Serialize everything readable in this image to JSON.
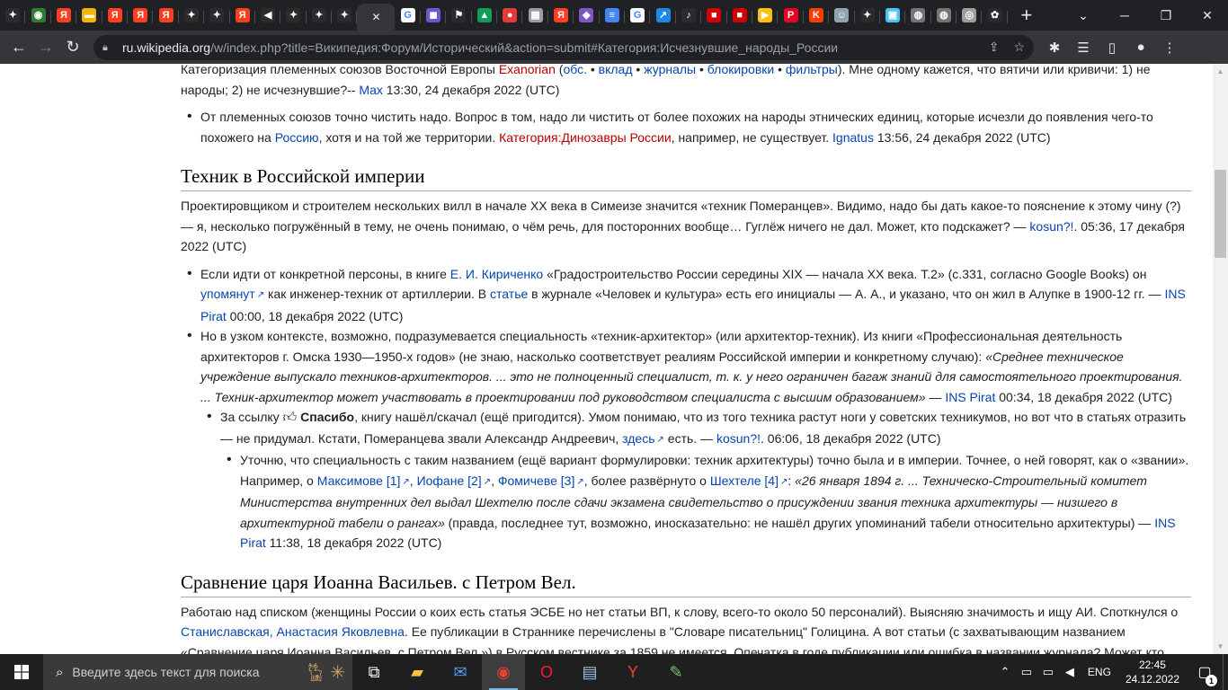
{
  "browser": {
    "tabs": [
      {
        "icon": "sparkle-icon",
        "color": "#2b2b2b",
        "glyph": "✦"
      },
      {
        "icon": "globe-icon",
        "color": "#2e7d32",
        "glyph": "◉"
      },
      {
        "icon": "yandex-icon",
        "color": "#fc3f1d",
        "glyph": "Я"
      },
      {
        "icon": "slides-icon",
        "color": "#f4b400",
        "glyph": "▬"
      },
      {
        "icon": "yandex-icon",
        "color": "#fc3f1d",
        "glyph": "Я"
      },
      {
        "icon": "yandex-icon",
        "color": "#fc3f1d",
        "glyph": "Я"
      },
      {
        "icon": "yandex-icon",
        "color": "#fc3f1d",
        "glyph": "Я"
      },
      {
        "icon": "sparkle-icon",
        "color": "#2b2b2b",
        "glyph": "✦"
      },
      {
        "icon": "sparkle-icon",
        "color": "#2b2b2b",
        "glyph": "✦"
      },
      {
        "icon": "yandex-icon",
        "color": "#fc3f1d",
        "glyph": "Я"
      },
      {
        "icon": "speaker-icon",
        "color": "#2b2b2b",
        "glyph": "◀"
      },
      {
        "icon": "sparkle-icon",
        "color": "#2b2b2b",
        "glyph": "✦"
      },
      {
        "icon": "sparkle-icon",
        "color": "#2b2b2b",
        "glyph": "✦"
      },
      {
        "icon": "sparkle-icon",
        "color": "#2b2b2b",
        "glyph": "✦"
      },
      {
        "icon": "google-icon",
        "color": "#ffffff",
        "glyph": "G"
      },
      {
        "icon": "media-icon",
        "color": "#6a5acd",
        "glyph": "◼"
      },
      {
        "icon": "flag-icon",
        "color": "#2b2b2b",
        "glyph": "⚑"
      },
      {
        "icon": "drive-icon",
        "color": "#0f9d58",
        "glyph": "▲"
      },
      {
        "icon": "pokeball-icon",
        "color": "#e53935",
        "glyph": "●"
      },
      {
        "icon": "image-icon",
        "color": "#9e9e9e",
        "glyph": "▦"
      },
      {
        "icon": "yandex-icon",
        "color": "#fc3f1d",
        "glyph": "Я"
      },
      {
        "icon": "games-icon",
        "color": "#7e57c2",
        "glyph": "◆"
      },
      {
        "icon": "docs-icon",
        "color": "#4285f4",
        "glyph": "≡"
      },
      {
        "icon": "google-icon",
        "color": "#ffffff",
        "glyph": "G"
      },
      {
        "icon": "chart-icon",
        "color": "#1e88e5",
        "glyph": "↗"
      },
      {
        "icon": "tiktok-icon",
        "color": "#2b2b2b",
        "glyph": "♪"
      },
      {
        "icon": "redflag-icon",
        "color": "#d50000",
        "glyph": "■"
      },
      {
        "icon": "redflag-icon",
        "color": "#d50000",
        "glyph": "■"
      },
      {
        "icon": "play-icon",
        "color": "#ffc107",
        "glyph": "▶"
      },
      {
        "icon": "pinterest-icon",
        "color": "#e60023",
        "glyph": "P"
      },
      {
        "icon": "kinopoisk-icon",
        "color": "#ff3d00",
        "glyph": "K"
      },
      {
        "icon": "avatar-icon",
        "color": "#90a4ae",
        "glyph": "☺"
      },
      {
        "icon": "sparkle-icon",
        "color": "#2b2b2b",
        "glyph": "✦"
      },
      {
        "icon": "photo-icon",
        "color": "#4fc3f7",
        "glyph": "▣"
      },
      {
        "icon": "globe-gray-icon",
        "color": "#757575",
        "glyph": "◍"
      },
      {
        "icon": "globe-gray-icon",
        "color": "#757575",
        "glyph": "◍"
      },
      {
        "icon": "chrome-icon",
        "color": "#9e9e9e",
        "glyph": "◎"
      },
      {
        "icon": "openai-icon",
        "color": "#2b2b2b",
        "glyph": "✿"
      }
    ],
    "active_tab_close": "✕",
    "new_tab": "+",
    "url_host": "ru.wikipedia.org",
    "url_rest": "/w/index.php?title=Википедия:Форум/Исторический&action=submit#Категория:Исчезнувшие_народы_России"
  },
  "article": {
    "top_p_parts": [
      "Категоризация племенных союзов Восточной Европы ",
      "Exanorian",
      " (",
      "обс.",
      " • ",
      "вклад",
      " • ",
      "журналы",
      " • ",
      "блокировки",
      " • ",
      "фильтры",
      "). Мне одному кажется, что вятичи или кривичи: 1) не народы; 2) не исчезнувшие?-- ",
      "Max",
      " 13:30, 24 декабря 2022 (UTC)"
    ],
    "reply1": {
      "t1": "От племенных союзов точно чистить надо. Вопрос в том, надо ли чистить от более похожих на народы этнических единиц, которые исчезли до появления чего-то похожего на ",
      "link1": "Россию",
      "t2": ", хотя и на той же территории. ",
      "link2": "Категория:Динозавры России",
      "t3": ", например, не существует. ",
      "link3": "Ignatus",
      "t4": " 13:56, 24 декабря 2022 (UTC)"
    },
    "heading1": "Техник в Российской империи",
    "p2": {
      "t1": "Проектировщиком и строителем нескольких вилл в начале XX века в Симеизе значится «техник Померанцев». Видимо, надо бы дать какое-то пояснение к этому чину (?) — я, несколько погружённый в тему, не очень понимаю, о чём речь, для посторонних вообще… Гуглёж ничего не дал. Может, кто подскажет? — ",
      "link1": "kosun?!",
      "t2": ". 05:36, 17 декабря 2022 (UTC)"
    },
    "reply2": {
      "t1": "Если идти от конкретной персоны, в книге ",
      "link1": "Е. И. Кириченко",
      "t2": " «Градостроительство России середины XIX — начала XX века. Т.2» (с.331, согласно Google Books) он ",
      "link2": "упомянут",
      "t3": " как инженер-техник от артиллерии. В ",
      "link3": "статье",
      "t4": " в журнале «Человек и культура» есть его инициалы — А. А., и указано, что он жил в Алупке в 1900-12 гг. — ",
      "link4": "INS Pirat",
      "t5": " 00:00, 18 декабря 2022 (UTC)"
    },
    "reply3": {
      "t1": "Но в узком контексте, возможно, подразумевается специальность «техник-архитектор» (или архитектор-техник). Из книги «Профессиональная деятельность архитекторов г. Омска 1930—1950-х годов» (не знаю, насколько соответствует реалиям Российской империи и конкретному случаю): ",
      "quote": "«Среднее техническое учреждение выпускало техников-архитекторов. ... это не полноценный специалист, т. к. у него ограничен багаж знаний для самостоятельного проектирования. ... Техник-архитектор может участвовать в проектировании под руководством специалиста с высшим образованием»",
      "t2": " — ",
      "link1": "INS Pirat",
      "t3": " 00:34, 18 декабря 2022 (UTC)"
    },
    "reply4": {
      "t1": "За ссылку ",
      "thanks": "Спасибо",
      "t2": ", книгу нашёл/скачал (ещё пригодится). Умом понимаю, что из того техника растут ноги у советских техникумов, но вот что в статьях отразить — не придумал. Кстати, Померанцева звали Александр Андреевич, ",
      "link1": "здесь",
      "t3": " есть. — ",
      "link2": "kosun?!",
      "t4": ". 06:06, 18 декабря 2022 (UTC)"
    },
    "reply5": {
      "t1": "Уточню, что специальность с таким названием (ещё вариант формулировки: техник архитектуры) точно была и в империи. Точнее, о ней говорят, как о «звании». Например, о ",
      "link1": "Максимове [1]",
      "t2": ", ",
      "link2": "Иофане [2]",
      "t3": ", ",
      "link3": "Фомичеве [3]",
      "t4": ", более развёрнуто о ",
      "link4": "Шехтеле [4]",
      "t5": ": ",
      "quote": "«26 января 1894 г. ... Техническо-Строительный комитет Министерства внутренних дел выдал Шехтелю после сдачи экзамена свидетельство о присуждении звания техника архитектуры — низшего в архитектурной табели о рангах»",
      "t6": " (правда, последнее тут, возможно, иносказательно: не нашёл других упоминаний табели относительно архитектуры) — ",
      "link5": "INS Pirat",
      "t7": " 11:38, 18 декабря 2022 (UTC)"
    },
    "heading2": "Сравнение царя Иоанна Васильев. с Петром Вел.",
    "p3": {
      "t1": "Работаю над списком (женщины России о коих есть статья ЭСБЕ но нет статьи ВП, к слову, всего-то около 50 персоналий). Выясняю значимость и ищу АИ. Споткнулся о ",
      "link1": "Станиславская, Анастасия Яковлевна",
      "t2": ". Ее публикации в Страннике перечислены в \"Словаре писательниц\" Голицина. А вот статьи (с захватывающим названием «Сравнение царя Иоанна Васильев. с Петром Вел.») в Русском вестнике за 1859 не имеется. Опечатка в годе публикации или ошибка в названии журнала? Может кто"
    }
  },
  "taskbar": {
    "search_placeholder": "Введите здесь текст для поиска",
    "lang": "ENG",
    "time": "22:45",
    "date": "24.12.2022",
    "notification_count": "1"
  },
  "colors": {
    "link": "#0645ad",
    "redlink": "#ba0000",
    "chrome_dark": "#202124",
    "chrome_toolbar": "#35363a"
  }
}
